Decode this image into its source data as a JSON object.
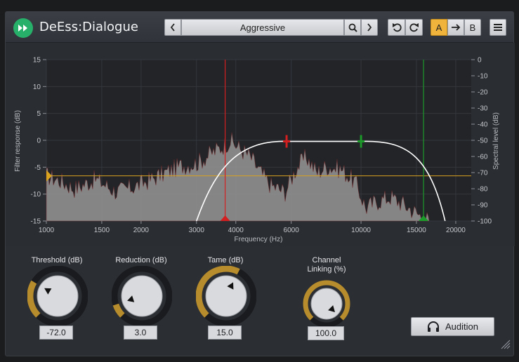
{
  "header": {
    "plugin_name": "DeEss:Dialogue",
    "preset_name": "Aggressive",
    "ab": {
      "a_label": "A",
      "b_label": "B"
    }
  },
  "graph": {
    "left_axis_label": "Filter response (dB)",
    "right_axis_label": "Spectral level (dB)",
    "x_axis_label": "Frequency (Hz)",
    "left_ticks": [
      "15",
      "10",
      "5",
      "0",
      "-5",
      "-10",
      "-15"
    ],
    "right_ticks": [
      "0",
      "-10",
      "-20",
      "-30",
      "-40",
      "-50",
      "-60",
      "-70",
      "-80",
      "-90",
      "-100"
    ],
    "x_ticks": [
      "1000",
      "1500",
      "2000",
      "3000",
      "4000",
      "6000",
      "10000",
      "15000",
      "20000"
    ],
    "threshold_level_db": -72,
    "low_marker_hz": 3700,
    "high_marker_hz": 15800,
    "colors": {
      "threshold": "#d9a21f",
      "low_marker": "#d31f1f",
      "high_marker": "#1c9a2a",
      "curve": "#ffffff",
      "spectrum": "#8e8e8e"
    }
  },
  "controls": {
    "threshold": {
      "label": "Threshold (dB)",
      "value": "-72.0"
    },
    "reduction": {
      "label": "Reduction (dB)",
      "value": "3.0"
    },
    "tame": {
      "label": "Tame (dB)",
      "value": "15.0"
    },
    "linking": {
      "label_line1": "Channel",
      "label_line2": "Linking (%)",
      "value": "100.0"
    }
  },
  "audition": {
    "label": "Audition",
    "icon": "headphones-icon"
  },
  "colors": {
    "accent": "#f0b43c",
    "knob_ring": "#b78c2c",
    "bypass": "#27b06a"
  }
}
